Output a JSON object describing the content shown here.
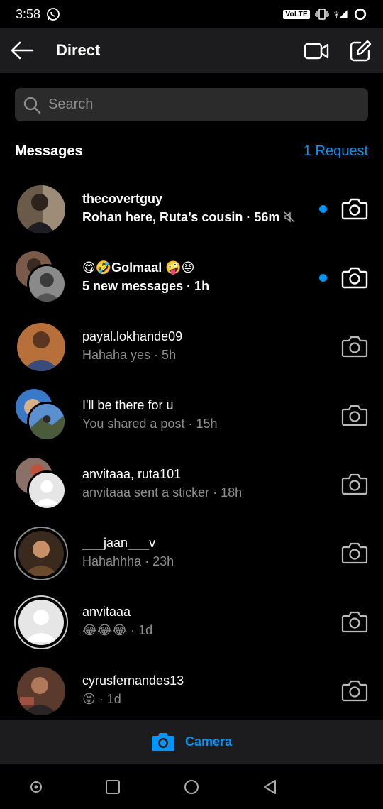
{
  "status_bar": {
    "time": "3:58",
    "volte": "VoLTE",
    "network": "4G"
  },
  "header": {
    "title": "Direct",
    "icons": [
      "back-arrow-icon",
      "video-call-icon",
      "compose-icon"
    ]
  },
  "search": {
    "placeholder": "Search"
  },
  "messages_section": {
    "heading": "Messages",
    "requests_link": "1 Request"
  },
  "threads": [
    {
      "name": "thecovertguy",
      "preview": "Rohan here, Ruta’s cousin · 56m",
      "unread": true,
      "muted": true
    },
    {
      "name": "😋🤣Golmaal 🤪😝",
      "preview": "5 new messages · 1h",
      "unread": true,
      "muted": false
    },
    {
      "name": "payal.lokhande09",
      "preview": "Hahaha yes · 5h",
      "unread": false
    },
    {
      "name": "I'll be there for u",
      "preview": "You shared a post · 15h",
      "unread": false
    },
    {
      "name": "anvitaaa, ruta101",
      "preview": "anvitaaa sent a sticker · 18h",
      "unread": false
    },
    {
      "name": "___jaan___v",
      "preview": "Hahahhha · 23h",
      "unread": false
    },
    {
      "name": "anvitaaa",
      "preview": "😂😂😂 · 1d",
      "unread": false
    },
    {
      "name": "cyrusfernandes13",
      "preview": "😝 · 1d",
      "unread": false
    }
  ],
  "camera_bar": {
    "label": "Camera"
  },
  "colors": {
    "accent": "#0095f6",
    "background": "#000000",
    "bar": "#1c1c1e",
    "secondary_text": "#8e8e8e"
  }
}
